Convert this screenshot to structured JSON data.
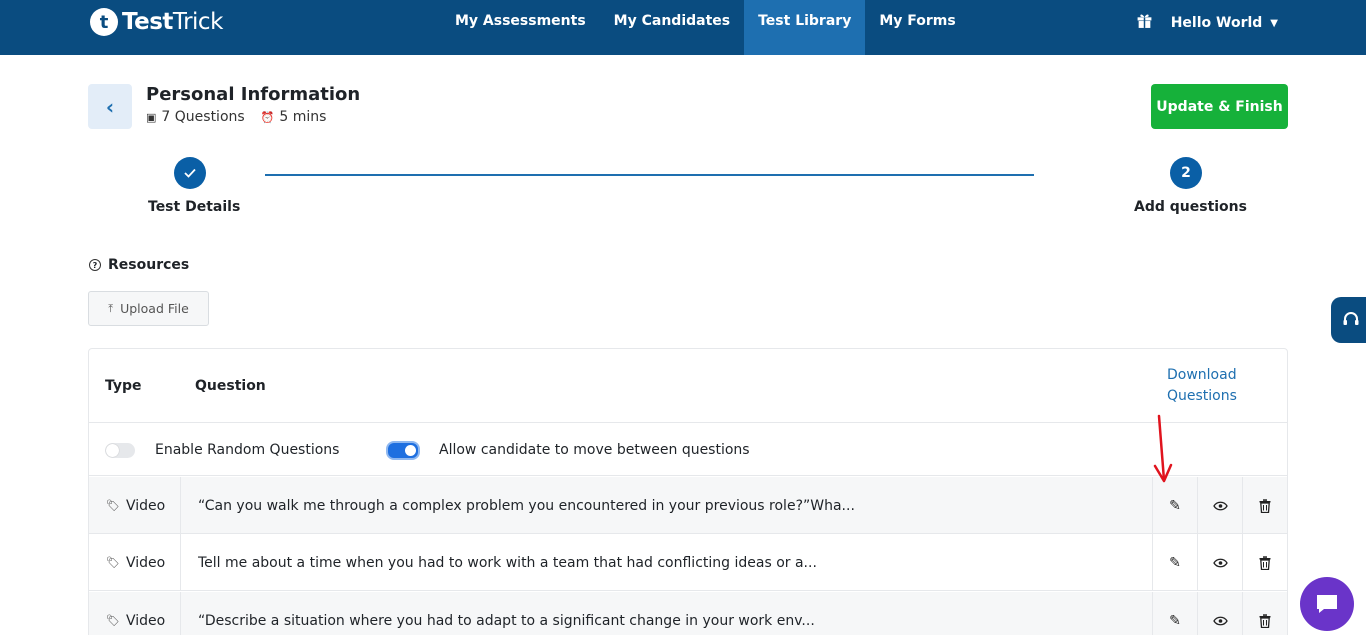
{
  "app": {
    "logo_letter": "t",
    "logo_bold": "Test",
    "logo_light": "Trick"
  },
  "nav": {
    "items": [
      {
        "label": "My Assessments",
        "active": false
      },
      {
        "label": "My Candidates",
        "active": false
      },
      {
        "label": "Test Library",
        "active": true
      },
      {
        "label": "My Forms",
        "active": false
      }
    ],
    "user_label": "Hello World",
    "gift_icon": "gift-icon"
  },
  "header": {
    "back_icon": "chevron-left-icon",
    "title": "Personal Information",
    "questions_count": "7 Questions",
    "duration": "5 mins",
    "finish_label": "Update & Finish"
  },
  "stepper": {
    "step1": {
      "label": "Test Details",
      "status": "done"
    },
    "step2": {
      "number": "2",
      "label": "Add questions",
      "status": "current"
    }
  },
  "resources": {
    "title": "Resources",
    "upload_label": "Upload File"
  },
  "table": {
    "col_type": "Type",
    "col_question": "Question",
    "download_label": "Download Questions",
    "toggle_random": {
      "label": "Enable Random Questions",
      "on": false
    },
    "toggle_move": {
      "label": "Allow candidate to move between questions",
      "on": true
    },
    "rows": [
      {
        "type": "Video",
        "question": "“Can you walk me through a complex problem you encountered in your previous role?”Wha..."
      },
      {
        "type": "Video",
        "question": "Tell me about a time when you had to work with a team that had conflicting ideas or a..."
      },
      {
        "type": "Video",
        "question": "“Describe a situation where you had to adapt to a significant change in your work env..."
      }
    ]
  },
  "colors": {
    "nav_bg": "#0a4c80",
    "nav_active": "#1e6fb0",
    "finish_green": "#16b13a",
    "accent_blue": "#1e6fb0",
    "chat_purple": "#6a34c9",
    "annotation_red": "#e0141e"
  }
}
